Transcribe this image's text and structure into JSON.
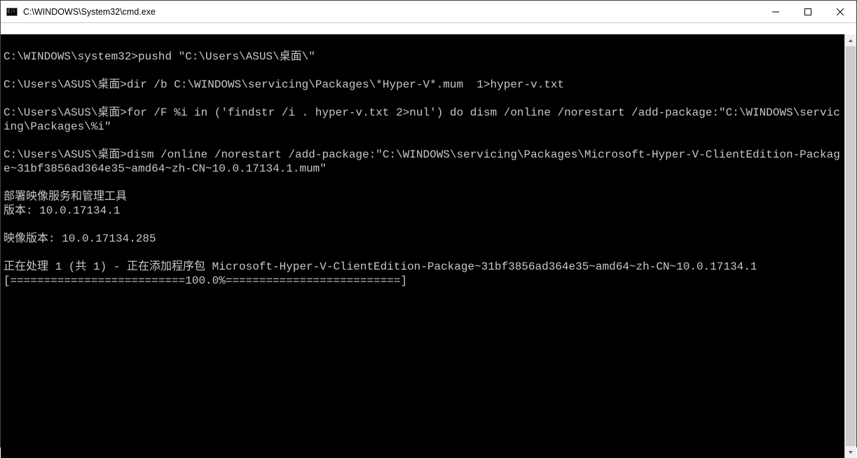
{
  "window": {
    "title": "C:\\WINDOWS\\System32\\cmd.exe"
  },
  "terminal": {
    "lines": [
      "",
      "C:\\WINDOWS\\system32>pushd \"C:\\Users\\ASUS\\桌面\\\"",
      "",
      "C:\\Users\\ASUS\\桌面>dir /b C:\\WINDOWS\\servicing\\Packages\\*Hyper-V*.mum  1>hyper-v.txt",
      "",
      "C:\\Users\\ASUS\\桌面>for /F %i in ('findstr /i . hyper-v.txt 2>nul') do dism /online /norestart /add-package:\"C:\\WINDOWS\\servicing\\Packages\\%i\"",
      "",
      "C:\\Users\\ASUS\\桌面>dism /online /norestart /add-package:\"C:\\WINDOWS\\servicing\\Packages\\Microsoft-Hyper-V-ClientEdition-Package~31bf3856ad364e35~amd64~zh-CN~10.0.17134.1.mum\"",
      "",
      "部署映像服务和管理工具",
      "版本: 10.0.17134.1",
      "",
      "映像版本: 10.0.17134.285",
      "",
      "正在处理 1 (共 1) - 正在添加程序包 Microsoft-Hyper-V-ClientEdition-Package~31bf3856ad364e35~amd64~zh-CN~10.0.17134.1",
      "[==========================100.0%==========================]"
    ]
  }
}
